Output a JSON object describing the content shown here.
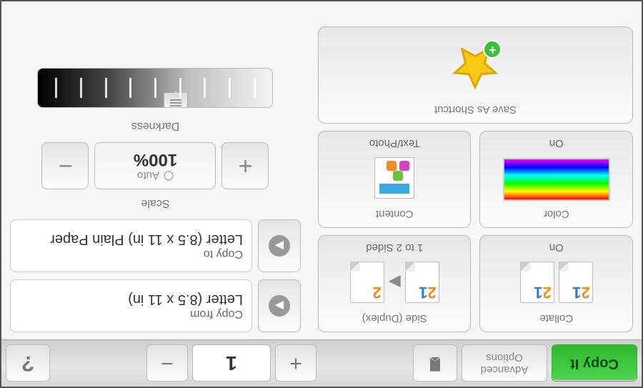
{
  "header": {
    "copy_it": "Copy It",
    "advanced_line1": "Advanced",
    "advanced_line2": "Options",
    "count": "1"
  },
  "tiles": {
    "collate": {
      "caption": "Collate",
      "value": "On"
    },
    "duplex": {
      "caption": "Side (Duplex)",
      "value": "1 to 2 Sided"
    },
    "color": {
      "caption": "Color",
      "value": "On"
    },
    "content": {
      "caption": "Content",
      "value": "Text/Photo"
    },
    "save_shortcut": {
      "caption": "Save As Shortcut"
    }
  },
  "fields": {
    "copy_from": {
      "label": "Copy from",
      "value": "Letter (8.5 x 11 in)"
    },
    "copy_to": {
      "label": "Copy to",
      "value": "Letter (8.5 x 11 in) Plain Paper"
    }
  },
  "scale": {
    "caption": "Scale",
    "auto": "Auto",
    "percent": "100%"
  },
  "darkness": {
    "caption": "Darkness",
    "ticks": 9,
    "position": 3
  }
}
